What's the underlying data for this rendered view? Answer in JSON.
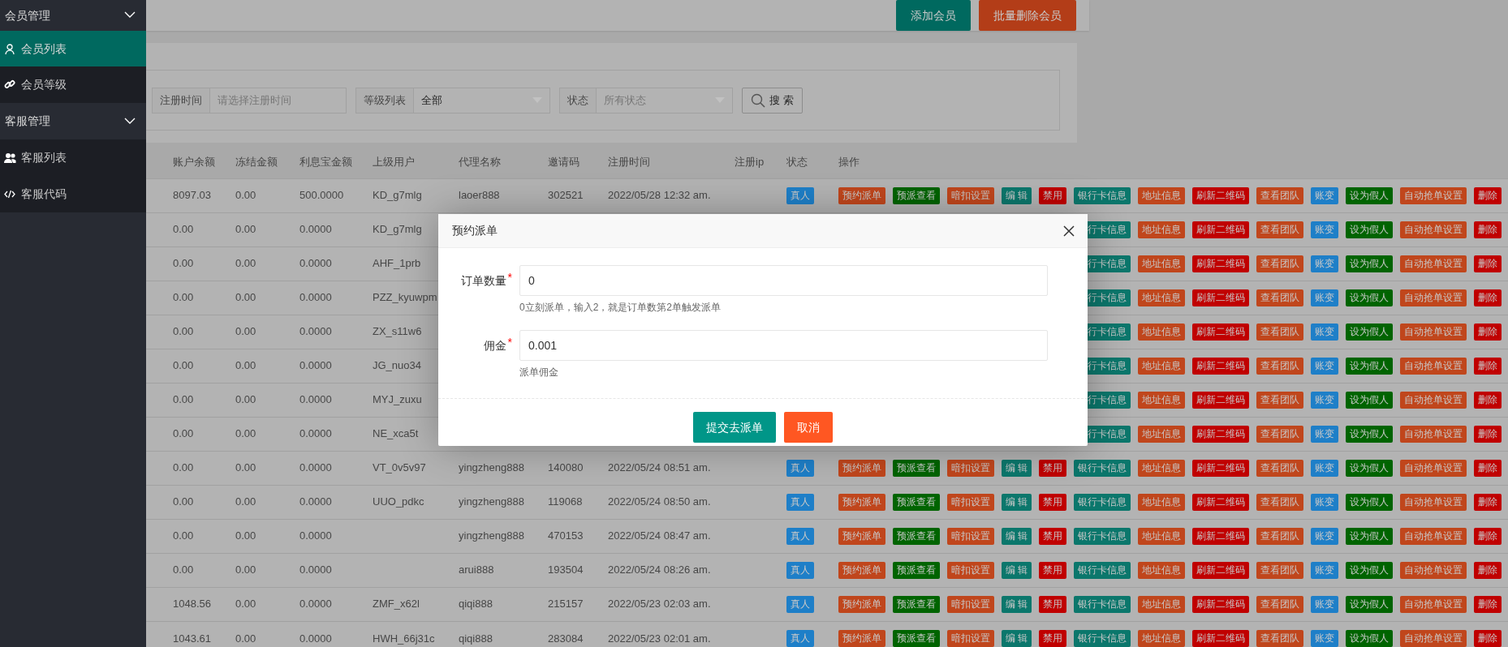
{
  "sidebar": {
    "items": [
      {
        "label": "会员管理",
        "expanded": true,
        "children": [
          {
            "label": "会员列表",
            "selected": true
          },
          {
            "label": "会员等级",
            "selected": false
          }
        ]
      },
      {
        "label": "客服管理",
        "expanded": true,
        "children": [
          {
            "label": "客服列表",
            "selected": false
          },
          {
            "label": "客服代码",
            "selected": false
          }
        ]
      }
    ]
  },
  "toolbar": {
    "buttons": [
      {
        "label": "添加会员",
        "color": "#00695f"
      },
      {
        "label": "批量删除会员",
        "color": "#b33d18"
      }
    ]
  },
  "search": {
    "fields": [
      {
        "label": "注册时间",
        "kind": "input",
        "placeholder": "请选择注册时间"
      },
      {
        "label": "等级列表",
        "kind": "select",
        "value": "全部"
      },
      {
        "label": "状态",
        "kind": "select",
        "placeholder": "所有状态"
      }
    ],
    "button": "搜 索"
  },
  "table": {
    "columns": [
      "账户余额",
      "冻结金额",
      "利息宝金额",
      "上级用户",
      "代理名称",
      "邀请码",
      "注册时间",
      "注册ip",
      "状态",
      "操作"
    ],
    "rows": [
      {
        "cells": [
          "8097.03",
          "0.00",
          "500.0000",
          "KD_g7mlg",
          "laoer888",
          "302521",
          "2022/05/28 12:32 am.",
          null
        ],
        "status": {
          "label": "真人",
          "color": "#1e7fc8"
        },
        "actions": [
          {
            "label": "预约派单",
            "color": "#c0461c"
          },
          {
            "label": "预派查看",
            "color": "#006400"
          },
          {
            "label": "暗扣设置",
            "color": "#c0461c"
          },
          {
            "label": "编 辑",
            "color": "#0b776c"
          },
          {
            "label": "禁用",
            "color": "#c00000"
          },
          {
            "label": "银行卡信息",
            "color": "#0b776c"
          },
          {
            "label": "地址信息",
            "color": "#c0461c"
          },
          {
            "label": "刷新二维码",
            "color": "#c00000"
          },
          {
            "label": "查看团队",
            "color": "#c0461c"
          },
          {
            "label": "账变",
            "color": "#1e7fc8"
          },
          {
            "label": "设为假人",
            "color": "#006400"
          },
          {
            "label": "自动抢单设置",
            "color": "#c0461c"
          },
          {
            "label": "删除",
            "color": "#c00000"
          }
        ]
      },
      {
        "cells": [
          "0.00",
          "0.00",
          "0.0000",
          "KD_g7mlg",
          null,
          null,
          null,
          null
        ],
        "actions": [
          {
            "label": "行卡信息",
            "color": "#0b776c"
          },
          {
            "label": "地址信息",
            "color": "#c0461c"
          },
          {
            "label": "刷新二维码",
            "color": "#c00000"
          },
          {
            "label": "查看团队",
            "color": "#c0461c"
          },
          {
            "label": "账变",
            "color": "#1e7fc8"
          },
          {
            "label": "设为假人",
            "color": "#006400"
          },
          {
            "label": "自动抢单设置",
            "color": "#c0461c"
          },
          {
            "label": "删除",
            "color": "#c00000"
          }
        ]
      },
      {
        "cells": [
          "0.00",
          "0.00",
          "0.0000",
          "AHF_1prb",
          null,
          null,
          null,
          null
        ],
        "actions": [
          {
            "label": "行卡信息",
            "color": "#0b776c"
          },
          {
            "label": "地址信息",
            "color": "#c0461c"
          },
          {
            "label": "刷新二维码",
            "color": "#c00000"
          },
          {
            "label": "查看团队",
            "color": "#c0461c"
          },
          {
            "label": "账变",
            "color": "#1e7fc8"
          },
          {
            "label": "设为假人",
            "color": "#006400"
          },
          {
            "label": "自动抢单设置",
            "color": "#c0461c"
          },
          {
            "label": "删除",
            "color": "#c00000"
          }
        ]
      },
      {
        "cells": [
          "0.00",
          "0.00",
          "0.0000",
          "PZZ_kyuwpm",
          null,
          null,
          null,
          null
        ],
        "actions": [
          {
            "label": "行卡信息",
            "color": "#0b776c"
          },
          {
            "label": "地址信息",
            "color": "#c0461c"
          },
          {
            "label": "刷新二维码",
            "color": "#c00000"
          },
          {
            "label": "查看团队",
            "color": "#c0461c"
          },
          {
            "label": "账变",
            "color": "#1e7fc8"
          },
          {
            "label": "设为假人",
            "color": "#006400"
          },
          {
            "label": "自动抢单设置",
            "color": "#c0461c"
          },
          {
            "label": "删除",
            "color": "#c00000"
          }
        ]
      },
      {
        "cells": [
          "0.00",
          "0.00",
          "0.0000",
          "ZX_s11w6",
          null,
          null,
          null,
          null
        ],
        "actions": [
          {
            "label": "行卡信息",
            "color": "#0b776c"
          },
          {
            "label": "地址信息",
            "color": "#c0461c"
          },
          {
            "label": "刷新二维码",
            "color": "#c00000"
          },
          {
            "label": "查看团队",
            "color": "#c0461c"
          },
          {
            "label": "账变",
            "color": "#1e7fc8"
          },
          {
            "label": "设为假人",
            "color": "#006400"
          },
          {
            "label": "自动抢单设置",
            "color": "#c0461c"
          },
          {
            "label": "删除",
            "color": "#c00000"
          }
        ]
      },
      {
        "cells": [
          "0.00",
          "0.00",
          "0.0000",
          "JG_nuo34",
          null,
          null,
          null,
          null
        ],
        "actions": [
          {
            "label": "行卡信息",
            "color": "#0b776c"
          },
          {
            "label": "地址信息",
            "color": "#c0461c"
          },
          {
            "label": "刷新二维码",
            "color": "#c00000"
          },
          {
            "label": "查看团队",
            "color": "#c0461c"
          },
          {
            "label": "账变",
            "color": "#1e7fc8"
          },
          {
            "label": "设为假人",
            "color": "#006400"
          },
          {
            "label": "自动抢单设置",
            "color": "#c0461c"
          },
          {
            "label": "删除",
            "color": "#c00000"
          }
        ]
      },
      {
        "cells": [
          "0.00",
          "0.00",
          "0.0000",
          "MYJ_zuxu",
          null,
          null,
          null,
          null
        ],
        "actions": [
          {
            "label": "行卡信息",
            "color": "#0b776c"
          },
          {
            "label": "地址信息",
            "color": "#c0461c"
          },
          {
            "label": "刷新二维码",
            "color": "#c00000"
          },
          {
            "label": "查看团队",
            "color": "#c0461c"
          },
          {
            "label": "账变",
            "color": "#1e7fc8"
          },
          {
            "label": "设为假人",
            "color": "#006400"
          },
          {
            "label": "自动抢单设置",
            "color": "#c0461c"
          },
          {
            "label": "删除",
            "color": "#c00000"
          }
        ]
      },
      {
        "cells": [
          "0.00",
          "0.00",
          "0.0000",
          "NE_xca5t",
          null,
          null,
          null,
          null
        ],
        "actions": [
          {
            "label": "行卡信息",
            "color": "#0b776c"
          },
          {
            "label": "地址信息",
            "color": "#c0461c"
          },
          {
            "label": "刷新二维码",
            "color": "#c00000"
          },
          {
            "label": "查看团队",
            "color": "#c0461c"
          },
          {
            "label": "账变",
            "color": "#1e7fc8"
          },
          {
            "label": "设为假人",
            "color": "#006400"
          },
          {
            "label": "自动抢单设置",
            "color": "#c0461c"
          },
          {
            "label": "删除",
            "color": "#c00000"
          }
        ]
      },
      {
        "cells": [
          "0.00",
          "0.00",
          "0.0000",
          "VT_0v5v97",
          "yingzheng888",
          "140080",
          "2022/05/24 08:51 am.",
          null
        ],
        "status": {
          "label": "真人",
          "color": "#1e7fc8"
        },
        "actions": [
          {
            "label": "预约派单",
            "color": "#c0461c"
          },
          {
            "label": "预派查看",
            "color": "#006400"
          },
          {
            "label": "暗扣设置",
            "color": "#c0461c"
          },
          {
            "label": "编 辑",
            "color": "#0b776c"
          },
          {
            "label": "禁用",
            "color": "#c00000"
          },
          {
            "label": "银行卡信息",
            "color": "#0b776c"
          },
          {
            "label": "地址信息",
            "color": "#c0461c"
          },
          {
            "label": "刷新二维码",
            "color": "#c00000"
          },
          {
            "label": "查看团队",
            "color": "#c0461c"
          },
          {
            "label": "账变",
            "color": "#1e7fc8"
          },
          {
            "label": "设为假人",
            "color": "#006400"
          },
          {
            "label": "自动抢单设置",
            "color": "#c0461c"
          },
          {
            "label": "删除",
            "color": "#c00000"
          }
        ]
      },
      {
        "cells": [
          "0.00",
          "0.00",
          "0.0000",
          "UUO_pdkc",
          "yingzheng888",
          "119068",
          "2022/05/24 08:50 am.",
          null
        ],
        "status": {
          "label": "真人",
          "color": "#1e7fc8"
        },
        "actions": [
          {
            "label": "预约派单",
            "color": "#c0461c"
          },
          {
            "label": "预派查看",
            "color": "#006400"
          },
          {
            "label": "暗扣设置",
            "color": "#c0461c"
          },
          {
            "label": "编 辑",
            "color": "#0b776c"
          },
          {
            "label": "禁用",
            "color": "#c00000"
          },
          {
            "label": "银行卡信息",
            "color": "#0b776c"
          },
          {
            "label": "地址信息",
            "color": "#c0461c"
          },
          {
            "label": "刷新二维码",
            "color": "#c00000"
          },
          {
            "label": "查看团队",
            "color": "#c0461c"
          },
          {
            "label": "账变",
            "color": "#1e7fc8"
          },
          {
            "label": "设为假人",
            "color": "#006400"
          },
          {
            "label": "自动抢单设置",
            "color": "#c0461c"
          },
          {
            "label": "删除",
            "color": "#c00000"
          }
        ]
      },
      {
        "cells": [
          "0.00",
          "0.00",
          "0.0000",
          null,
          "yingzheng888",
          "470153",
          "2022/05/24 08:47 am.",
          null
        ],
        "status": {
          "label": "真人",
          "color": "#1e7fc8"
        },
        "actions": [
          {
            "label": "预约派单",
            "color": "#c0461c"
          },
          {
            "label": "预派查看",
            "color": "#006400"
          },
          {
            "label": "暗扣设置",
            "color": "#c0461c"
          },
          {
            "label": "编 辑",
            "color": "#0b776c"
          },
          {
            "label": "禁用",
            "color": "#c00000"
          },
          {
            "label": "银行卡信息",
            "color": "#0b776c"
          },
          {
            "label": "地址信息",
            "color": "#c0461c"
          },
          {
            "label": "刷新二维码",
            "color": "#c00000"
          },
          {
            "label": "查看团队",
            "color": "#c0461c"
          },
          {
            "label": "账变",
            "color": "#1e7fc8"
          },
          {
            "label": "设为假人",
            "color": "#006400"
          },
          {
            "label": "自动抢单设置",
            "color": "#c0461c"
          },
          {
            "label": "删除",
            "color": "#c00000"
          }
        ]
      },
      {
        "cells": [
          "0.00",
          "0.00",
          "0.0000",
          null,
          "arui888",
          "193504",
          "2022/05/24 08:26 am.",
          null
        ],
        "status": {
          "label": "真人",
          "color": "#1e7fc8"
        },
        "actions": [
          {
            "label": "预约派单",
            "color": "#c0461c"
          },
          {
            "label": "预派查看",
            "color": "#006400"
          },
          {
            "label": "暗扣设置",
            "color": "#c0461c"
          },
          {
            "label": "编 辑",
            "color": "#0b776c"
          },
          {
            "label": "禁用",
            "color": "#c00000"
          },
          {
            "label": "银行卡信息",
            "color": "#0b776c"
          },
          {
            "label": "地址信息",
            "color": "#c0461c"
          },
          {
            "label": "刷新二维码",
            "color": "#c00000"
          },
          {
            "label": "查看团队",
            "color": "#c0461c"
          },
          {
            "label": "账变",
            "color": "#1e7fc8"
          },
          {
            "label": "设为假人",
            "color": "#006400"
          },
          {
            "label": "自动抢单设置",
            "color": "#c0461c"
          },
          {
            "label": "删除",
            "color": "#c00000"
          }
        ]
      },
      {
        "cells": [
          "1048.56",
          "0.00",
          "0.0000",
          "ZMF_x62l",
          "qiqi888",
          "215157",
          "2022/05/23 02:03 am.",
          null
        ],
        "status": {
          "label": "真人",
          "color": "#1e7fc8"
        },
        "actions": [
          {
            "label": "预约派单",
            "color": "#c0461c"
          },
          {
            "label": "预派查看",
            "color": "#006400"
          },
          {
            "label": "暗扣设置",
            "color": "#c0461c"
          },
          {
            "label": "编 辑",
            "color": "#0b776c"
          },
          {
            "label": "禁用",
            "color": "#c00000"
          },
          {
            "label": "银行卡信息",
            "color": "#0b776c"
          },
          {
            "label": "地址信息",
            "color": "#c0461c"
          },
          {
            "label": "刷新二维码",
            "color": "#c00000"
          },
          {
            "label": "查看团队",
            "color": "#c0461c"
          },
          {
            "label": "账变",
            "color": "#1e7fc8"
          },
          {
            "label": "设为假人",
            "color": "#006400"
          },
          {
            "label": "自动抢单设置",
            "color": "#c0461c"
          },
          {
            "label": "删除",
            "color": "#c00000"
          }
        ]
      },
      {
        "cells": [
          "1043.61",
          "0.00",
          "0.0000",
          "HWH_66j31c",
          "qiqi888",
          "283084",
          "2022/05/23 02:01 am.",
          null
        ],
        "status": {
          "label": "真人",
          "color": "#1e7fc8"
        },
        "actions": [
          {
            "label": "预约派单",
            "color": "#c0461c"
          },
          {
            "label": "预派查看",
            "color": "#006400"
          },
          {
            "label": "暗扣设置",
            "color": "#c0461c"
          },
          {
            "label": "编 辑",
            "color": "#0b776c"
          },
          {
            "label": "禁用",
            "color": "#c00000"
          },
          {
            "label": "银行卡信息",
            "color": "#0b776c"
          },
          {
            "label": "地址信息",
            "color": "#c0461c"
          },
          {
            "label": "刷新二维码",
            "color": "#c00000"
          },
          {
            "label": "查看团队",
            "color": "#c0461c"
          },
          {
            "label": "账变",
            "color": "#1e7fc8"
          },
          {
            "label": "设为假人",
            "color": "#006400"
          },
          {
            "label": "自动抢单设置",
            "color": "#c0461c"
          },
          {
            "label": "删除",
            "color": "#c00000"
          }
        ]
      }
    ]
  },
  "modal": {
    "title": "预约派单",
    "fields": [
      {
        "label": "订单数量",
        "required_mark": "*",
        "value": "0",
        "help": "0立刻派单，输入2，就是订单数第2单触发派单"
      },
      {
        "label": "佣金",
        "required_mark": "*",
        "value": "0.001",
        "help": "派单佣金"
      }
    ],
    "buttons": [
      {
        "label": "提交去派单",
        "color": "#009688"
      },
      {
        "label": "取消",
        "color": "#ff5722"
      }
    ]
  }
}
